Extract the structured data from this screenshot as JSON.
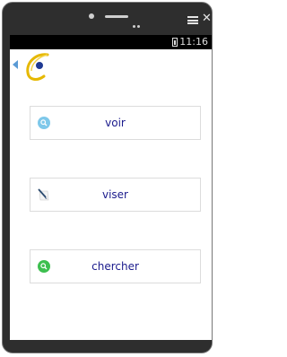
{
  "device": {
    "status_time": "11:16"
  },
  "app": {
    "buttons": [
      {
        "label": "voir",
        "icon": "search-icon",
        "icon_color": "#7ec8ea"
      },
      {
        "label": "viser",
        "icon": "document-pen-icon",
        "icon_color": "#2b4a6f"
      },
      {
        "label": "chercher",
        "icon": "search-icon",
        "icon_color": "#3dbf4f"
      }
    ]
  }
}
